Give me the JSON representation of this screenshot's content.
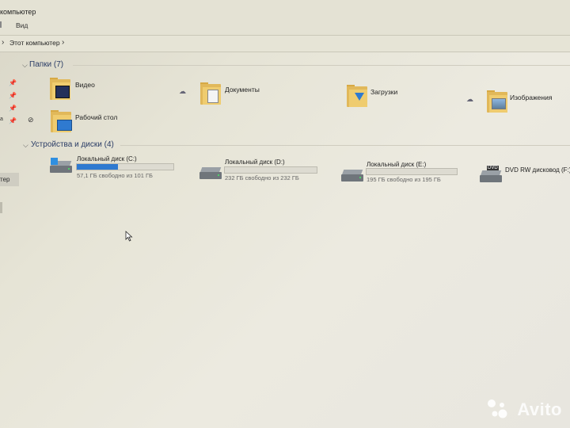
{
  "window": {
    "title": "компьютер"
  },
  "menu": {
    "view_label": "Вид"
  },
  "address": {
    "path_label": "Этот компьютер"
  },
  "nav": {
    "selected_label": "тер",
    "partial_label": "а"
  },
  "folders_group": {
    "title": "Папки (7)",
    "items": [
      {
        "label": "Видео",
        "icon": "video-folder-icon"
      },
      {
        "label": "Документы",
        "icon": "documents-folder-icon"
      },
      {
        "label": "Загрузки",
        "icon": "downloads-folder-icon"
      },
      {
        "label": "Изображения",
        "icon": "pictures-folder-icon"
      },
      {
        "label": "Рабочий стол",
        "icon": "desktop-folder-icon"
      }
    ]
  },
  "devices_group": {
    "title": "Устройства и диски (4)",
    "items": [
      {
        "label": "Локальный диск (C:)",
        "free": "57,1 ГБ свободно из 101 ГБ",
        "used_fraction": 0.43,
        "icon": "windows-drive-icon"
      },
      {
        "label": "Локальный диск (D:)",
        "free": "232 ГБ свободно из 232 ГБ",
        "used_fraction": 0.0,
        "icon": "hard-drive-icon"
      },
      {
        "label": "Локальный диск (E:)",
        "free": "195 ГБ свободно из 195 ГБ",
        "used_fraction": 0.0,
        "icon": "hard-drive-icon"
      },
      {
        "label": "DVD RW дисковод (F:)",
        "icon": "dvd-drive-icon"
      }
    ]
  },
  "watermark": {
    "text": "Avito"
  },
  "colors": {
    "accent": "#2f7ad0",
    "group_title": "#2b3d66",
    "folder": "#efcc6f"
  }
}
